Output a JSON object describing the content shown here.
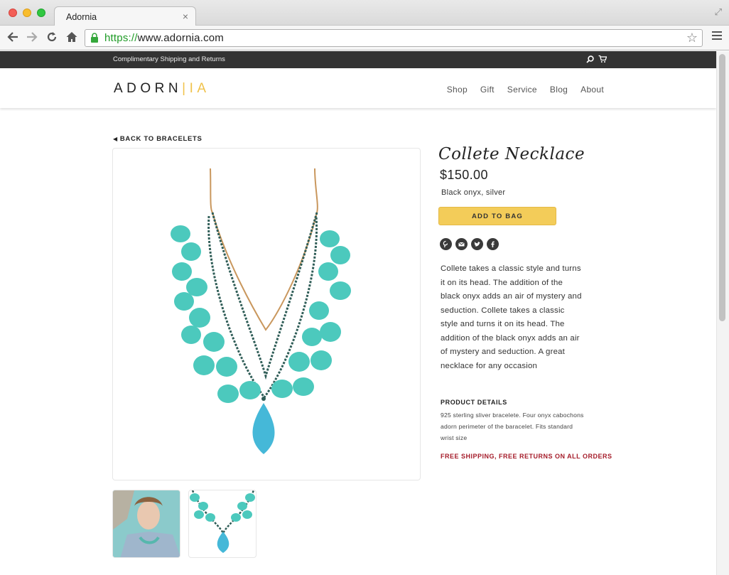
{
  "browser": {
    "tab_title": "Adornia",
    "tab_close": "×",
    "url_scheme": "https://",
    "url_rest": "www.adornia.com"
  },
  "promo": {
    "text": "Complimentary Shipping and Returns"
  },
  "header": {
    "logo_main": "ADORN",
    "logo_accent": "IA",
    "nav": [
      "Shop",
      "Gift",
      "Service",
      "Blog",
      "About"
    ]
  },
  "product": {
    "back_link": "BACK TO BRACELETS",
    "title": "Collete Necklace",
    "price": "$150.00",
    "material": "Black onyx, silver",
    "add_to_bag": "ADD TO BAG",
    "description": "Collete takes a classic style and turns it on its head. The addition of the black onyx adds an air of mystery and seduction. Collete takes a classic style and turns it on its head. The addition of the black onyx adds an air of mystery and seduction. A great necklace for any occasion",
    "details_heading": "PRODUCT DETAILS",
    "details_body": "925 sterling sliver bracelete. Four onyx cabochons adorn perimeter of the baracelet. Fits standard wrist size",
    "shipping_note": "FREE SHIPPING, FREE RETURNS ON ALL ORDERS"
  },
  "colors": {
    "accent": "#f0c24b",
    "button": "#f3cc59",
    "shipping_red": "#a51c2a",
    "promo_bar": "#333333",
    "stone": "#4cc9bd"
  },
  "icons": {
    "social": [
      "pinterest-icon",
      "email-icon",
      "twitter-icon",
      "facebook-icon"
    ]
  }
}
